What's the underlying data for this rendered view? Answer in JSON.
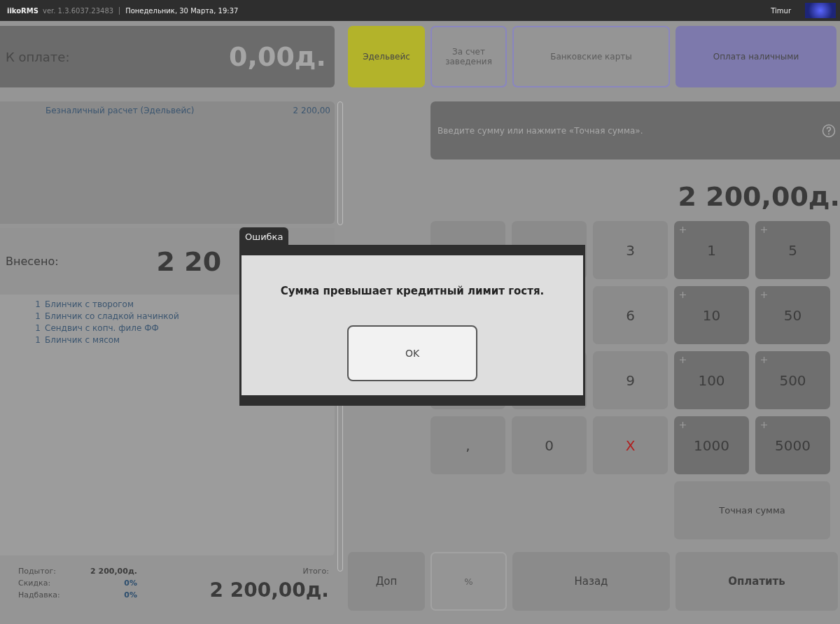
{
  "top_bar": {
    "app_name": "iikoRMS",
    "version": "ver. 1.3.6037.23483",
    "datetime": "Понедельник, 30 Марта, 19:37",
    "user": "Timur"
  },
  "due": {
    "label": "К оплате:",
    "amount": "0,00д."
  },
  "payment_methods": [
    {
      "label": "Эдельвейс",
      "kind": "filled",
      "color": "#b3b32a"
    },
    {
      "label": "За счет заведения",
      "kind": "outline",
      "color": "#8a86c0"
    },
    {
      "label": "Банковские карты",
      "kind": "outline",
      "color": "#8a86c0"
    },
    {
      "label": "Оплата наличными",
      "kind": "filled",
      "color": "#7d79ac"
    }
  ],
  "payments": [
    {
      "name": "Безналичный расчет (Эдельвейс)",
      "amount": "2 200,00"
    }
  ],
  "hint": "Введите сумму или нажмите «Точная сумма».",
  "entered_amount": "2 200,00д.",
  "paid": {
    "label": "Внесено:",
    "amount": "2 20"
  },
  "order_items": [
    {
      "qty": "1",
      "name": "Блинчик с творогом"
    },
    {
      "qty": "1",
      "name": "Блинчик со сладкой начинкой"
    },
    {
      "qty": "1",
      "name": "Сендвич с копч. филе ФФ"
    },
    {
      "qty": "1",
      "name": "Блинчик с мясом"
    }
  ],
  "keypad_rows": [
    [
      {
        "kind": "blank"
      },
      {
        "kind": "blank"
      },
      {
        "kind": "digit",
        "label": "3"
      },
      {
        "kind": "quick",
        "label": "1"
      },
      {
        "kind": "quick",
        "label": "5"
      }
    ],
    [
      {
        "kind": "digit",
        "label": "6"
      },
      {
        "kind": "quick",
        "label": "10"
      },
      {
        "kind": "quick",
        "label": "50"
      }
    ],
    [
      {
        "kind": "blank"
      },
      {
        "kind": "blank"
      },
      {
        "kind": "digit",
        "label": "9"
      },
      {
        "kind": "quick",
        "label": "100"
      },
      {
        "kind": "quick",
        "label": "500"
      }
    ],
    [
      {
        "kind": "digit",
        "label": ","
      },
      {
        "kind": "digit",
        "label": "0"
      },
      {
        "kind": "clear",
        "label": "X"
      },
      {
        "kind": "quick",
        "label": "1000"
      },
      {
        "kind": "quick",
        "label": "5000"
      }
    ]
  ],
  "exact_button": "Точная сумма",
  "totals": {
    "subtotal_label": "Подытог:",
    "subtotal": "2 200,00д.",
    "discount_label": "Скидка:",
    "discount": "0%",
    "markup_label": "Надбавка:",
    "markup": "0%",
    "total_label": "Итого:",
    "total": "2 200,00д."
  },
  "actions": [
    {
      "label": "Доп",
      "kind": "normal"
    },
    {
      "label": "%",
      "kind": "disabled"
    },
    {
      "label": "Назад",
      "kind": "normal"
    },
    {
      "label": "Оплатить",
      "kind": "primary"
    }
  ],
  "dialog": {
    "title": "Ошибка",
    "message": "Сумма превышает кредитный лимит гостя.",
    "button": "OK"
  }
}
